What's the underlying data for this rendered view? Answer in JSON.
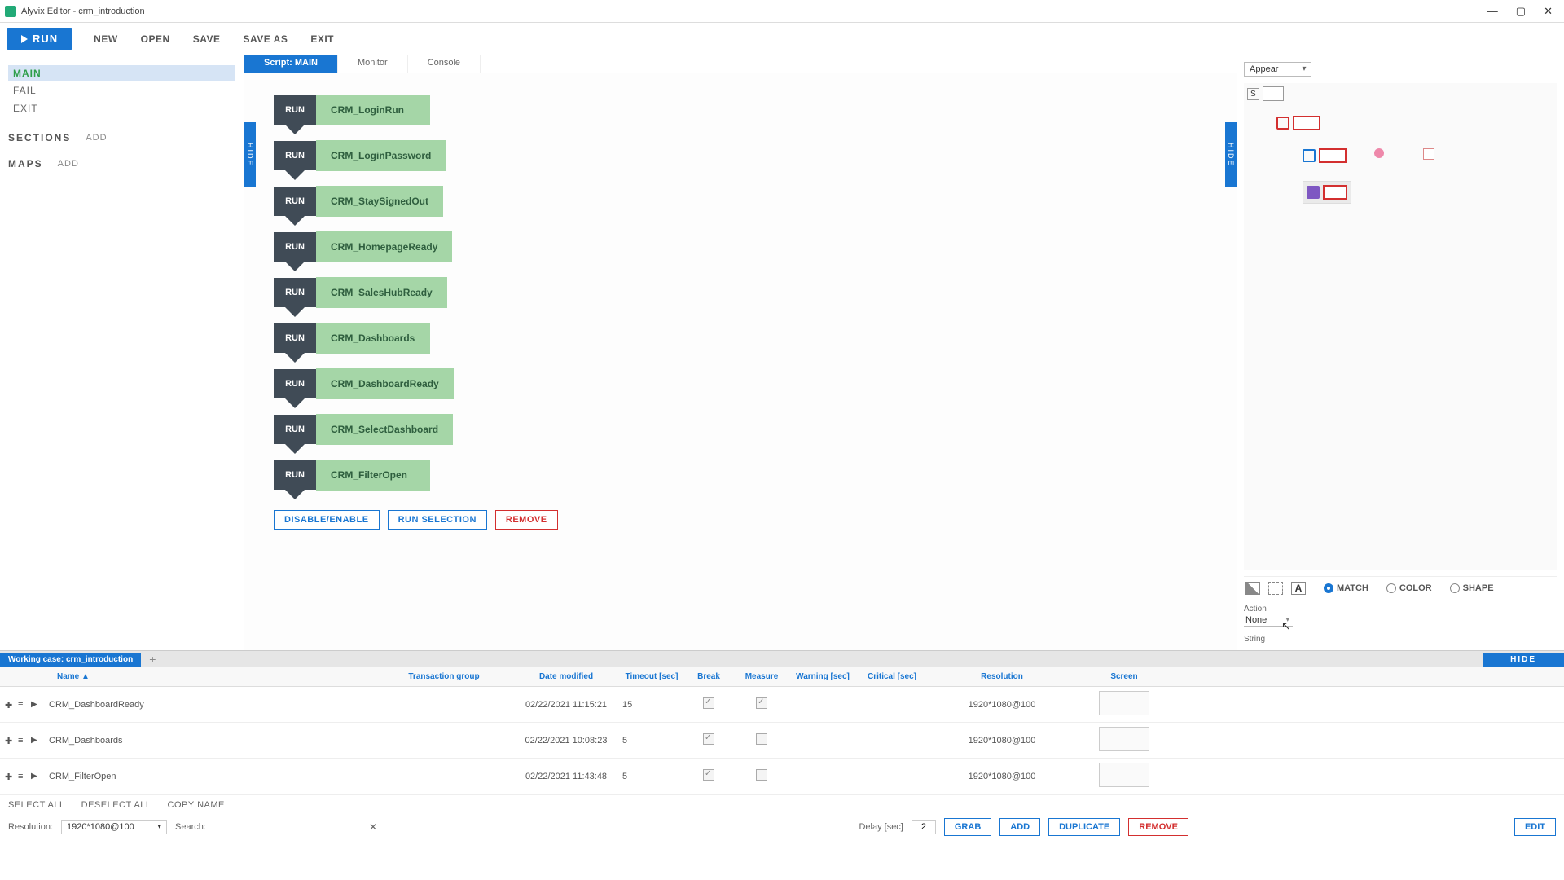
{
  "window": {
    "title": "Alyvix Editor - crm_introduction"
  },
  "toolbar": {
    "run": "RUN",
    "new": "NEW",
    "open": "OPEN",
    "save": "SAVE",
    "save_as": "SAVE AS",
    "exit": "EXIT"
  },
  "left": {
    "main": "MAIN",
    "fail": "FAIL",
    "exit": "EXIT",
    "sections": "SECTIONS",
    "add": "ADD",
    "maps": "MAPS"
  },
  "tabs": {
    "script": "Script: MAIN",
    "monitor": "Monitor",
    "console": "Console"
  },
  "hide": "HIDE",
  "steps": {
    "run": "RUN",
    "items": [
      "CRM_LoginRun",
      "CRM_LoginPassword",
      "CRM_StaySignedOut",
      "CRM_HomepageReady",
      "CRM_SalesHubReady",
      "CRM_Dashboards",
      "CRM_DashboardReady",
      "CRM_SelectDashboard",
      "CRM_FilterOpen"
    ]
  },
  "canvas_actions": {
    "disable": "DISABLE/ENABLE",
    "run_sel": "RUN SELECTION",
    "remove": "REMOVE"
  },
  "right": {
    "appear": "Appear",
    "s": "S",
    "match": "MATCH",
    "color": "COLOR",
    "shape": "SHAPE",
    "action": "Action",
    "action_val": "None",
    "string": "String",
    "edit": "EDIT"
  },
  "work_tab": "Working case: crm_introduction",
  "grid": {
    "headers": {
      "name": "Name ▲",
      "tg": "Transaction group",
      "dm": "Date modified",
      "to": "Timeout [sec]",
      "br": "Break",
      "ms": "Measure",
      "wr": "Warning [sec]",
      "cr": "Critical [sec]",
      "rs": "Resolution",
      "sc": "Screen"
    },
    "rows": [
      {
        "name": "CRM_DashboardReady",
        "dm": "02/22/2021 11:15:21",
        "to": "15",
        "br": true,
        "ms": true,
        "rs": "1920*1080@100"
      },
      {
        "name": "CRM_Dashboards",
        "dm": "02/22/2021 10:08:23",
        "to": "5",
        "br": true,
        "ms": false,
        "rs": "1920*1080@100"
      },
      {
        "name": "CRM_FilterOpen",
        "dm": "02/22/2021 11:43:48",
        "to": "5",
        "br": true,
        "ms": false,
        "rs": "1920*1080@100"
      }
    ]
  },
  "bottom": {
    "select_all": "SELECT ALL",
    "deselect_all": "DESELECT ALL",
    "copy_name": "COPY NAME",
    "resolution": "Resolution:",
    "res_val": "1920*1080@100",
    "search": "Search:",
    "delay": "Delay [sec]",
    "delay_val": "2",
    "grab": "GRAB",
    "add": "ADD",
    "duplicate": "DUPLICATE",
    "remove": "REMOVE"
  }
}
